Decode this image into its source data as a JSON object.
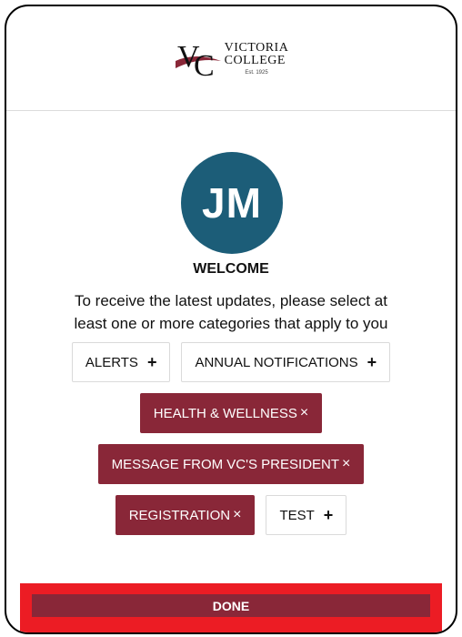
{
  "brand": {
    "line1": "VICTORIA",
    "line2": "COLLEGE",
    "est": "Est. 1925",
    "color": "#892738"
  },
  "user": {
    "initials": "JM",
    "avatar_color": "#1c5d78"
  },
  "welcome": {
    "heading": "WELCOME",
    "line1": "To receive the latest updates, please select at",
    "line2": "least one or more categories that apply to you"
  },
  "categories": [
    {
      "label": "ALERTS",
      "selected": false,
      "icon": "+"
    },
    {
      "label": "ANNUAL NOTIFICATIONS",
      "selected": false,
      "icon": "+"
    },
    {
      "label": "HEALTH & WELLNESS",
      "selected": true,
      "icon": "×"
    },
    {
      "label": "MESSAGE FROM VC'S PRESIDENT",
      "selected": true,
      "icon": "×"
    },
    {
      "label": "REGISTRATION",
      "selected": true,
      "icon": "×"
    },
    {
      "label": "TEST",
      "selected": false,
      "icon": "+"
    }
  ],
  "footer": {
    "done_label": "DONE",
    "highlight_color": "#ec1c24"
  }
}
